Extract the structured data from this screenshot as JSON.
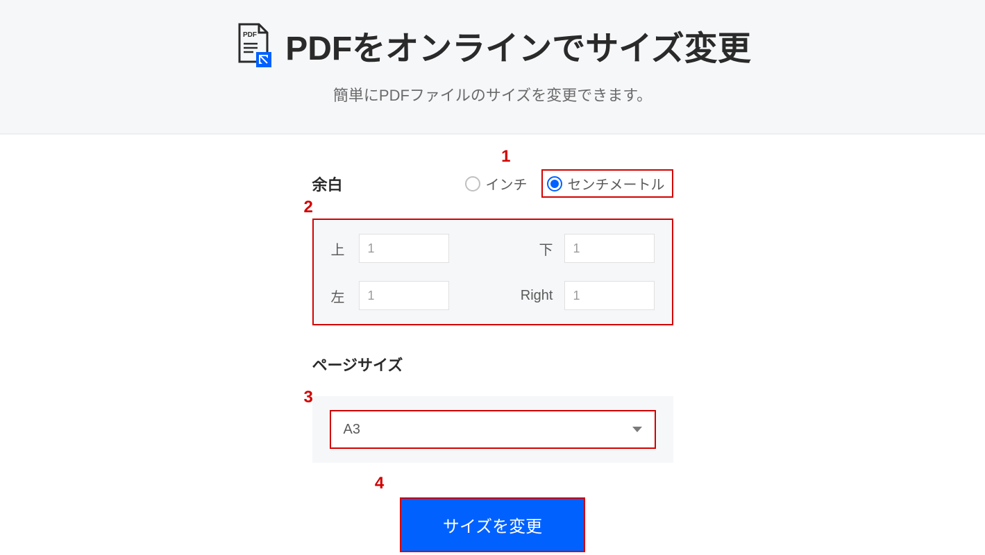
{
  "header": {
    "title": "PDFをオンラインでサイズ変更",
    "subtitle": "簡単にPDFファイルのサイズを変更できます。",
    "icon_label": "PDF"
  },
  "margins": {
    "section_label": "余白",
    "unit_options": {
      "inch": "インチ",
      "cm": "センチメートル"
    },
    "selected_unit": "cm",
    "labels": {
      "top": "上",
      "bottom": "下",
      "left": "左",
      "right": "Right"
    },
    "values": {
      "top": "1",
      "bottom": "1",
      "left": "1",
      "right": "1"
    }
  },
  "page_size": {
    "label": "ページサイズ",
    "selected": "A3"
  },
  "actions": {
    "resize_button": "サイズを変更"
  },
  "annotations": {
    "a1": "1",
    "a2": "2",
    "a3": "3",
    "a4": "4"
  }
}
